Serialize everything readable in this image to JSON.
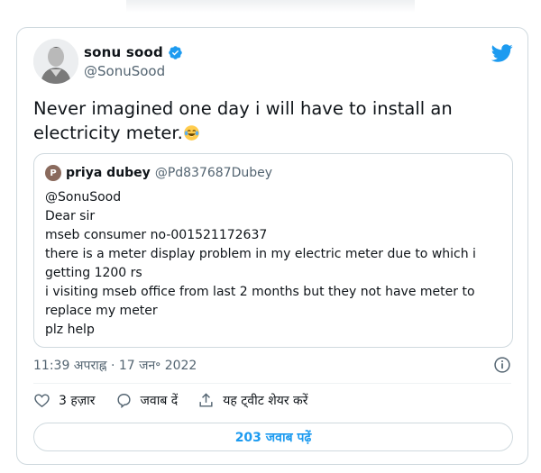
{
  "author": {
    "name": "sonu sood",
    "handle": "@SonuSood"
  },
  "tweet": {
    "text": "Never imagined one day i will have to install an electricity meter.",
    "emoji_icon": "tears-of-joy-emoji-icon"
  },
  "quoted": {
    "avatar_letter": "P",
    "name": "priya dubey",
    "handle": "@Pd837687Dubey",
    "lines": [
      "@SonuSood",
      "Dear sir",
      "mseb consumer no-001521172637",
      "there is a meter display problem in my electric meter due to which i getting 1200 rs",
      "i visiting mseb office from last 2 months but they not have meter to replace my meter",
      "plz help"
    ]
  },
  "timestamp": "11:39 अपराह्न · 17 जन॰ 2022",
  "actions": {
    "likes_label": "3 हज़ार",
    "reply_label": "जवाब दें",
    "share_label": "यह ट्वीट शेयर करें"
  },
  "read_replies_label": "203 जवाब पढ़ें",
  "colors": {
    "accent": "#1d9bf0",
    "secondary_text": "#536471",
    "border": "#cfd9de"
  }
}
